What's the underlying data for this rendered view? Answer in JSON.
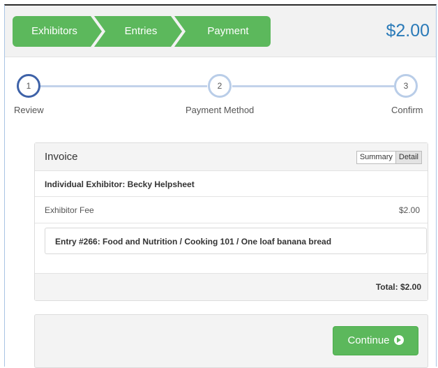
{
  "breadcrumbs": [
    "Exhibitors",
    "Entries",
    "Payment"
  ],
  "header": {
    "total": "$2.00"
  },
  "steps": [
    {
      "number": "1",
      "label": "Review"
    },
    {
      "number": "2",
      "label": "Payment Method"
    },
    {
      "number": "3",
      "label": "Confirm"
    }
  ],
  "invoice": {
    "title": "Invoice",
    "view_options": [
      "Summary",
      "Detail"
    ],
    "selected_view": "Detail",
    "exhibitor": "Individual Exhibitor: Becky Helpsheet",
    "fee_label": "Exhibitor Fee",
    "fee_amount": "$2.00",
    "entry": "Entry #266: Food and Nutrition / Cooking 101 / One loaf banana bread",
    "total": "Total: $2.00"
  },
  "actions": {
    "continue_label": "Continue"
  },
  "colors": {
    "accent_green": "#5cb85c",
    "price_blue": "#2a7ab8",
    "step_active": "#3e62a8"
  }
}
